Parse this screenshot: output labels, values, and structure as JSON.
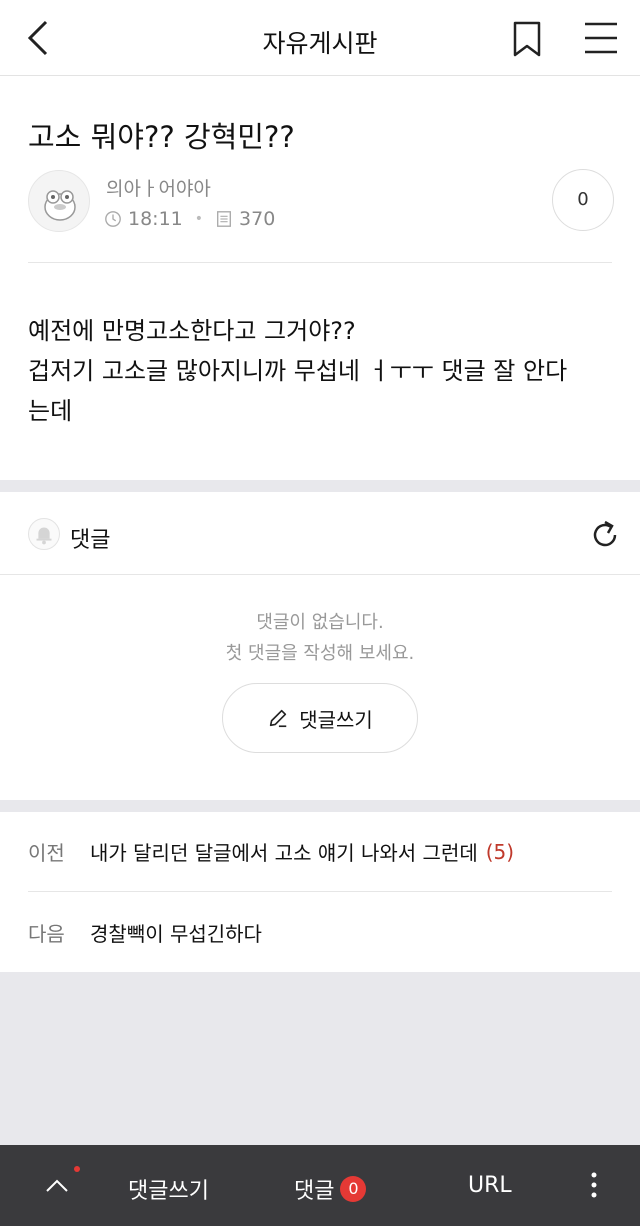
{
  "header": {
    "title": "자유게시판",
    "back_icon": "chevron-left-icon",
    "bookmark_icon": "bookmark-icon",
    "menu_icon": "hamburger-menu-icon"
  },
  "post": {
    "title": "고소 뭐야?? 강혁민??",
    "author": "의아ㅏ어야아",
    "time": "18:11",
    "views": "370",
    "count": "0",
    "body_lines": [
      "예전에 만명고소한다고 그거야??",
      "겁저기 고소글 많아지니까 무섭네 ㅓㅜㅜ 댓글 잘 안다",
      "는데"
    ]
  },
  "comments": {
    "label": "댓글",
    "empty_line1": "댓글이 없습니다.",
    "empty_line2": "첫 댓글을 작성해 보세요.",
    "write_button": "댓글쓰기"
  },
  "navigation": {
    "prev_label": "이전",
    "prev_title": "내가 달리던 달글에서 고소 얘기 나와서 그런데",
    "prev_count": "(5)",
    "next_label": "다음",
    "next_title": "경찰빽이 무섭긴하다"
  },
  "bottom_bar": {
    "write_label": "댓글쓰기",
    "comments_label": "댓글",
    "comments_count": "0",
    "url_label": "URL"
  },
  "colors": {
    "accent_red": "#e53935",
    "bottom_bar_bg": "#3a3a3d",
    "count_red": "#c0392b"
  }
}
